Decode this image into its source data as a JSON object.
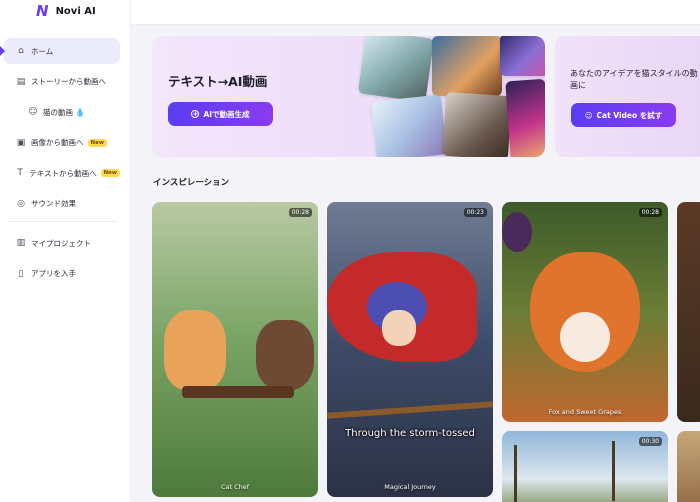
{
  "app": {
    "name": "Novi AI",
    "logo_mark": "N"
  },
  "sidebar": {
    "items": [
      {
        "label": "ホーム",
        "icon": "home-icon",
        "glyph": "⌂"
      },
      {
        "label": "ストーリーから動画へ",
        "icon": "story-icon",
        "glyph": "▤"
      },
      {
        "label": "猫の動画",
        "icon": "cat-icon",
        "glyph": "☺",
        "suffix": "💧"
      },
      {
        "label": "画像から動画へ",
        "icon": "image-icon",
        "glyph": "▣",
        "badge": "New"
      },
      {
        "label": "テキストから動画へ",
        "icon": "text-icon",
        "glyph": "T",
        "badge": "New"
      },
      {
        "label": "サウンド効果",
        "icon": "sound-icon",
        "glyph": "◎"
      },
      {
        "label": "マイプロジェクト",
        "icon": "folder-icon",
        "glyph": "▥"
      },
      {
        "label": "アプリを入手",
        "icon": "phone-icon",
        "glyph": "▯"
      }
    ]
  },
  "banners": {
    "text_to_video": {
      "title": "テキスト→AI動画",
      "button": "AIで動画生成",
      "button_icon": "+"
    },
    "cat_video": {
      "text": "あなたのアイデアを猫スタイルの動画に",
      "button": "Cat Video を試す",
      "button_icon": "☺"
    }
  },
  "inspiration": {
    "title": "インスピレーション",
    "cards": [
      {
        "label": "Cat Chef",
        "duration": "00:28"
      },
      {
        "label": "Magical Journey",
        "duration": "00:23",
        "subtitle": "Through the storm-tossed"
      },
      {
        "label": "Fox and Sweet Grapes",
        "duration": "00:28"
      },
      {
        "label": "",
        "duration": ""
      },
      {
        "label": "",
        "duration": "00:30"
      },
      {
        "label": "",
        "duration": ""
      }
    ]
  },
  "colors": {
    "accent": "#6a3df0",
    "button_gradient_end": "#8b3bf0",
    "badge": "#ffd84d"
  }
}
